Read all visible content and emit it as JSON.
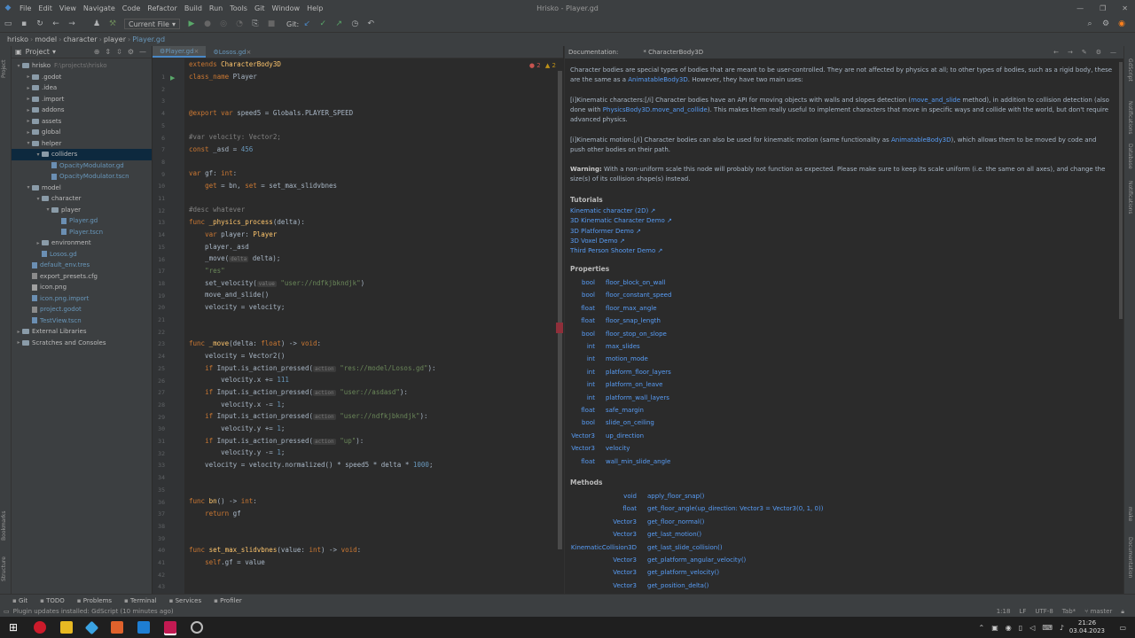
{
  "window": {
    "title": "Hrisko - Player.gd"
  },
  "menu": [
    "File",
    "Edit",
    "View",
    "Navigate",
    "Code",
    "Refactor",
    "Build",
    "Run",
    "Tools",
    "Git",
    "Window",
    "Help"
  ],
  "toolbar": {
    "run_config": "Current File",
    "git_label": "Git:"
  },
  "breadcrumbs": [
    "hrisko",
    "model",
    "character",
    "player",
    "Player.gd"
  ],
  "project": {
    "header": "Project",
    "items": [
      {
        "depth": 0,
        "arrow": "▾",
        "kind": "folder",
        "label": "hrisko",
        "extra": "F:\\projects\\hrisko",
        "sel": false
      },
      {
        "depth": 1,
        "arrow": "▸",
        "kind": "folder",
        "label": ".godot",
        "extra": "",
        "sel": false
      },
      {
        "depth": 1,
        "arrow": "▸",
        "kind": "folder",
        "label": ".idea",
        "extra": "",
        "sel": false
      },
      {
        "depth": 1,
        "arrow": "▸",
        "kind": "folder",
        "label": ".import",
        "extra": "",
        "sel": false
      },
      {
        "depth": 1,
        "arrow": "▸",
        "kind": "folder",
        "label": "addons",
        "extra": "",
        "sel": false
      },
      {
        "depth": 1,
        "arrow": "▸",
        "kind": "folder",
        "label": "assets",
        "extra": "",
        "sel": false
      },
      {
        "depth": 1,
        "arrow": "▸",
        "kind": "folder",
        "label": "global",
        "extra": "",
        "sel": false
      },
      {
        "depth": 1,
        "arrow": "▾",
        "kind": "folder",
        "label": "helper",
        "extra": "",
        "sel": false
      },
      {
        "depth": 2,
        "arrow": "▾",
        "kind": "folder",
        "label": "colliders",
        "extra": "",
        "sel": true
      },
      {
        "depth": 3,
        "arrow": "",
        "kind": "file",
        "label": "OpacityModulator.gd",
        "extra": "",
        "sel": false,
        "blue": true
      },
      {
        "depth": 3,
        "arrow": "",
        "kind": "file",
        "label": "OpacityModulator.tscn",
        "extra": "",
        "sel": false,
        "blue": true
      },
      {
        "depth": 1,
        "arrow": "▾",
        "kind": "folder",
        "label": "model",
        "extra": "",
        "sel": false
      },
      {
        "depth": 2,
        "arrow": "▾",
        "kind": "folder",
        "label": "character",
        "extra": "",
        "sel": false
      },
      {
        "depth": 3,
        "arrow": "▾",
        "kind": "folder",
        "label": "player",
        "extra": "",
        "sel": false
      },
      {
        "depth": 4,
        "arrow": "",
        "kind": "file",
        "label": "Player.gd",
        "extra": "",
        "sel": false,
        "blue": true
      },
      {
        "depth": 4,
        "arrow": "",
        "kind": "file",
        "label": "Player.tscn",
        "extra": "",
        "sel": false,
        "blue": true
      },
      {
        "depth": 2,
        "arrow": "▸",
        "kind": "folder",
        "label": "environment",
        "extra": "",
        "sel": false
      },
      {
        "depth": 2,
        "arrow": "",
        "kind": "file",
        "label": "Losos.gd",
        "extra": "",
        "sel": false,
        "blue": true
      },
      {
        "depth": 1,
        "arrow": "",
        "kind": "file",
        "label": "default_env.tres",
        "extra": "",
        "sel": false,
        "blue": true
      },
      {
        "depth": 1,
        "arrow": "",
        "kind": "cfg",
        "label": "export_presets.cfg",
        "extra": "",
        "sel": false
      },
      {
        "depth": 1,
        "arrow": "",
        "kind": "png",
        "label": "icon.png",
        "extra": "",
        "sel": false
      },
      {
        "depth": 1,
        "arrow": "",
        "kind": "file",
        "label": "icon.png.import",
        "extra": "",
        "sel": false,
        "blue": true
      },
      {
        "depth": 1,
        "arrow": "",
        "kind": "cfg",
        "label": "project.godot",
        "extra": "",
        "sel": false,
        "blue": true
      },
      {
        "depth": 1,
        "arrow": "",
        "kind": "file",
        "label": "TestView.tscn",
        "extra": "",
        "sel": false,
        "blue": true
      },
      {
        "depth": 0,
        "arrow": "▸",
        "kind": "folder",
        "label": "External Libraries",
        "extra": "",
        "sel": false
      },
      {
        "depth": 0,
        "arrow": "▸",
        "kind": "folder",
        "label": "Scratches and Consoles",
        "extra": "",
        "sel": false
      }
    ]
  },
  "editor": {
    "tabs": [
      "Player.gd",
      "Losos.gd"
    ],
    "inspections": {
      "errors": "2",
      "warnings": "2"
    },
    "lines": [
      [
        [
          "kw",
          "extends "
        ],
        [
          "fn",
          "CharacterBody3D"
        ]
      ],
      [
        [
          "kw",
          "class_name "
        ],
        [
          "ty",
          "Player"
        ]
      ],
      [],
      [],
      [
        [
          "kw",
          "@export var "
        ],
        [
          "ty",
          "speed5 = "
        ],
        [
          "ty",
          "Globals.PLAYER_SPEED"
        ]
      ],
      [],
      [
        [
          "cm",
          "#var velocity: Vector2;"
        ]
      ],
      [
        [
          "kw",
          "const "
        ],
        [
          "ty",
          "_asd = "
        ],
        [
          "num",
          "456"
        ]
      ],
      [],
      [
        [
          "kw",
          "var "
        ],
        [
          "ty",
          "gf: "
        ],
        [
          "kw",
          "int"
        ],
        [
          "ty",
          ":"
        ]
      ],
      [
        [
          "ty",
          "    "
        ],
        [
          "kw",
          "get"
        ],
        [
          "ty",
          " = bn, "
        ],
        [
          "kw",
          "set"
        ],
        [
          "ty",
          " = set_max_slidvbnes"
        ]
      ],
      [],
      [
        [
          "cm",
          "#desc whatever"
        ]
      ],
      [
        [
          "kw",
          "func "
        ],
        [
          "fn",
          "_physics_process"
        ],
        [
          "ty",
          "(delta):"
        ]
      ],
      [
        [
          "ty",
          "    "
        ],
        [
          "kw",
          "var "
        ],
        [
          "ty",
          "player: "
        ],
        [
          "fn",
          "Player"
        ]
      ],
      [
        [
          "ty",
          "    player._asd"
        ]
      ],
      [
        [
          "ty",
          "    _move("
        ],
        [
          "hint",
          "delta"
        ],
        [
          "ty",
          " delta);"
        ]
      ],
      [
        [
          "ty",
          "    "
        ],
        [
          "str",
          "\"res\""
        ]
      ],
      [
        [
          "ty",
          "    set_velocity("
        ],
        [
          "hint",
          "value"
        ],
        [
          "ty",
          " "
        ],
        [
          "str",
          "\"user://ndfkjbkndjk\""
        ],
        [
          "ty",
          ")"
        ]
      ],
      [
        [
          "ty",
          "    move_and_slide()"
        ]
      ],
      [
        [
          "ty",
          "    velocity = velocity;"
        ]
      ],
      [],
      [],
      [
        [
          "kw",
          "func "
        ],
        [
          "fn",
          "_move"
        ],
        [
          "ty",
          "(delta: "
        ],
        [
          "kw",
          "float"
        ],
        [
          "ty",
          ") -> "
        ],
        [
          "kw",
          "void"
        ],
        [
          "ty",
          ":"
        ]
      ],
      [
        [
          "ty",
          "    velocity = Vector2()"
        ]
      ],
      [
        [
          "ty",
          "    "
        ],
        [
          "kw",
          "if "
        ],
        [
          "ty",
          "Input.is_action_pressed("
        ],
        [
          "hint",
          "action"
        ],
        [
          "ty",
          " "
        ],
        [
          "str",
          "\"res://model/Losos.gd\""
        ],
        [
          "ty",
          "):"
        ]
      ],
      [
        [
          "ty",
          "        velocity.x += "
        ],
        [
          "num",
          "111"
        ]
      ],
      [
        [
          "ty",
          "    "
        ],
        [
          "kw",
          "if "
        ],
        [
          "ty",
          "Input.is_action_pressed("
        ],
        [
          "hint",
          "action"
        ],
        [
          "ty",
          " "
        ],
        [
          "str",
          "\"user://asdasd\""
        ],
        [
          "ty",
          "):"
        ]
      ],
      [
        [
          "ty",
          "        velocity.x -= "
        ],
        [
          "num",
          "1"
        ],
        [
          "ty",
          ";"
        ]
      ],
      [
        [
          "ty",
          "    "
        ],
        [
          "kw",
          "if "
        ],
        [
          "ty",
          "Input.is_action_pressed("
        ],
        [
          "hint",
          "action"
        ],
        [
          "ty",
          " "
        ],
        [
          "str",
          "\"user://ndfkjbkndjk\""
        ],
        [
          "ty",
          "):"
        ]
      ],
      [
        [
          "ty",
          "        velocity.y += "
        ],
        [
          "num",
          "1"
        ],
        [
          "ty",
          ";"
        ]
      ],
      [
        [
          "ty",
          "    "
        ],
        [
          "kw",
          "if "
        ],
        [
          "ty",
          "Input.is_action_pressed("
        ],
        [
          "hint",
          "action"
        ],
        [
          "ty",
          " "
        ],
        [
          "str",
          "\"up\""
        ],
        [
          "ty",
          "):"
        ]
      ],
      [
        [
          "ty",
          "        velocity.y -= "
        ],
        [
          "num",
          "1"
        ],
        [
          "ty",
          ";"
        ]
      ],
      [
        [
          "ty",
          "    velocity = velocity.normalized() * speed5 * delta * "
        ],
        [
          "num",
          "1000"
        ],
        [
          "ty",
          ";"
        ]
      ],
      [],
      [],
      [
        [
          "kw",
          "func "
        ],
        [
          "fn",
          "bn"
        ],
        [
          "ty",
          "() -> "
        ],
        [
          "kw",
          "int"
        ],
        [
          "ty",
          ":"
        ]
      ],
      [
        [
          "ty",
          "    "
        ],
        [
          "kw",
          "return "
        ],
        [
          "ty",
          "gf"
        ]
      ],
      [],
      [],
      [
        [
          "kw",
          "func "
        ],
        [
          "fn",
          "set_max_slidvbnes"
        ],
        [
          "ty",
          "(value: "
        ],
        [
          "kw",
          "int"
        ],
        [
          "ty",
          ") -> "
        ],
        [
          "kw",
          "void"
        ],
        [
          "ty",
          ":"
        ]
      ],
      [
        [
          "ty",
          "    "
        ],
        [
          "kw",
          "self"
        ],
        [
          "ty",
          ".gf = value"
        ]
      ],
      [],
      []
    ]
  },
  "doc": {
    "header": "Documentation:",
    "tab": "CharacterBody3D",
    "p1": "Character bodies are special types of bodies that are meant to be user-controlled. They are not affected by physics at all; to other types of bodies, such as a rigid body, these are the same as a ",
    "p1_link": "AnimatableBody3D",
    "p1_end": ". However, they have two main uses:",
    "p2": "[i]Kinematic characters:[/i] Character bodies have an API for moving objects with walls and slopes detection (",
    "p2_link1": "move_and_slide",
    "p2_mid": " method), in addition to collision detection (also done with ",
    "p2_link2": "PhysicsBody3D.move_and_collide",
    "p2_end": "). This makes them really useful to implement characters that move in specific ways and collide with the world, but don't require advanced physics.",
    "p3": "[i]Kinematic motion:[/i] Character bodies can also be used for kinematic motion (same functionality as ",
    "p3_link": "AnimatableBody3D",
    "p3_end": "), which allows them to be moved by code and push other bodies on their path.",
    "warning_label": "Warning:",
    "warning": " With a non-uniform scale this node will probably not function as expected. Please make sure to keep its scale uniform (i.e. the same on all axes), and change the size(s) of its collision shape(s) instead.",
    "tutorials_title": "Tutorials",
    "tutorials": [
      "Kinematic character (2D) ↗",
      "3D Kinematic Character Demo ↗",
      "3D Platformer Demo ↗",
      "3D Voxel Demo ↗",
      "Third Person Shooter Demo ↗"
    ],
    "properties_title": "Properties",
    "properties": [
      [
        "bool",
        "floor_block_on_wall"
      ],
      [
        "bool",
        "floor_constant_speed"
      ],
      [
        "float",
        "floor_max_angle"
      ],
      [
        "float",
        "floor_snap_length"
      ],
      [
        "bool",
        "floor_stop_on_slope"
      ],
      [
        "int",
        "max_slides"
      ],
      [
        "int",
        "motion_mode"
      ],
      [
        "int",
        "platform_floor_layers"
      ],
      [
        "int",
        "platform_on_leave"
      ],
      [
        "int",
        "platform_wall_layers"
      ],
      [
        "float",
        "safe_margin"
      ],
      [
        "bool",
        "slide_on_ceiling"
      ],
      [
        "Vector3",
        "up_direction"
      ],
      [
        "Vector3",
        "velocity"
      ],
      [
        "float",
        "wall_min_slide_angle"
      ]
    ],
    "methods_title": "Methods",
    "methods": [
      [
        "void",
        "apply_floor_snap()"
      ],
      [
        "float",
        "get_floor_angle(up_direction: Vector3 = Vector3(0, 1, 0))"
      ],
      [
        "Vector3",
        "get_floor_normal()"
      ],
      [
        "Vector3",
        "get_last_motion()"
      ],
      [
        "KinematicCollision3D",
        "get_last_slide_collision()"
      ],
      [
        "Vector3",
        "get_platform_angular_velocity()"
      ],
      [
        "Vector3",
        "get_platform_velocity()"
      ],
      [
        "Vector3",
        "get_position_delta()"
      ]
    ]
  },
  "left_strip": [
    "Project",
    "Bookmarks",
    "Structure"
  ],
  "right_strip": [
    "GdScript",
    "Notifications",
    "Database",
    "Notifications",
    "make",
    "Documentation"
  ],
  "toolwindows": [
    "Git",
    "TODO",
    "Problems",
    "Terminal",
    "Services",
    "Profiler"
  ],
  "status": {
    "message": "Plugin updates installed: GdScript (10 minutes ago)",
    "position": "1:18",
    "line_sep": "LF",
    "encoding": "UTF-8",
    "indent": "Tab*",
    "branch": "master"
  },
  "clock": {
    "time": "21:26",
    "date": "03.04.2023"
  },
  "colors": {
    "accent": "#4a88c7",
    "keyword": "#cc7832",
    "function": "#ffc66d",
    "string": "#6a8759",
    "link": "#589df6"
  }
}
